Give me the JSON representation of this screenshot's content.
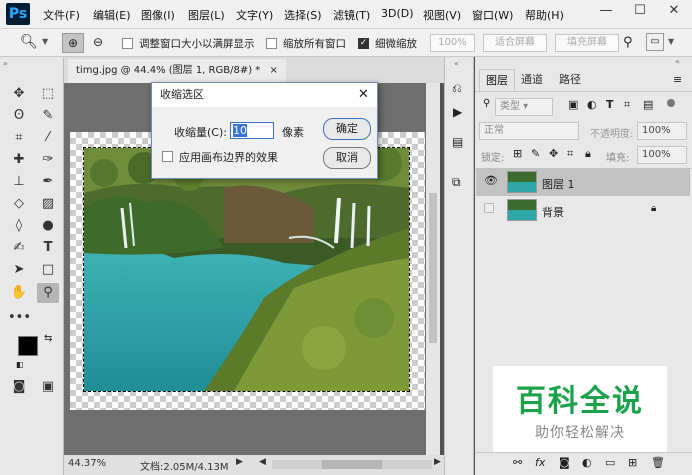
{
  "app": {
    "logo": "Ps"
  },
  "menu": [
    "文件(F)",
    "编辑(E)",
    "图像(I)",
    "图层(L)",
    "文字(Y)",
    "选择(S)",
    "滤镜(T)",
    "3D(D)",
    "视图(V)",
    "窗口(W)",
    "帮助(H)"
  ],
  "window_controls": {
    "minimize": "—",
    "maximize": "☐",
    "close": "✕"
  },
  "options": {
    "resize_windows_label": "调整窗口大小以满屏显示",
    "zoom_all_label": "缩放所有窗口",
    "scrubby_zoom_label": "细微缩放",
    "zoom_percent": "100%",
    "fit_screen": "适合屏幕",
    "fill_screen": "填充屏幕"
  },
  "document": {
    "tab_title": "timg.jpg @ 44.4% (图层 1, RGB/8#) *",
    "tab_close": "×",
    "zoom": "44.37%",
    "doc_info": "文档:2.05M/4.13M"
  },
  "panels": {
    "tabs": [
      "图层",
      "通道",
      "路径"
    ],
    "kind_filter": "类型",
    "blend_mode": "正常",
    "opacity_label": "不透明度:",
    "opacity_value": "100%",
    "lock_label": "锁定:",
    "fill_label": "填充:",
    "fill_value": "100%",
    "layers": [
      {
        "name": "图层 1",
        "visible": true,
        "selected": true
      },
      {
        "name": "背景",
        "visible": false,
        "selected": false,
        "locked": true
      }
    ]
  },
  "dialog": {
    "title": "收缩选区",
    "contract_label": "收缩量(C):",
    "contract_value": "10",
    "unit": "像素",
    "apply_canvas_label": "应用画布边界的效果",
    "ok": "确定",
    "cancel": "取消"
  },
  "watermark": {
    "title": "百科全说",
    "subtitle": "助你轻松解决"
  },
  "colors": {
    "accent": "#31a8ff",
    "watermark_green": "#1aa34a"
  }
}
